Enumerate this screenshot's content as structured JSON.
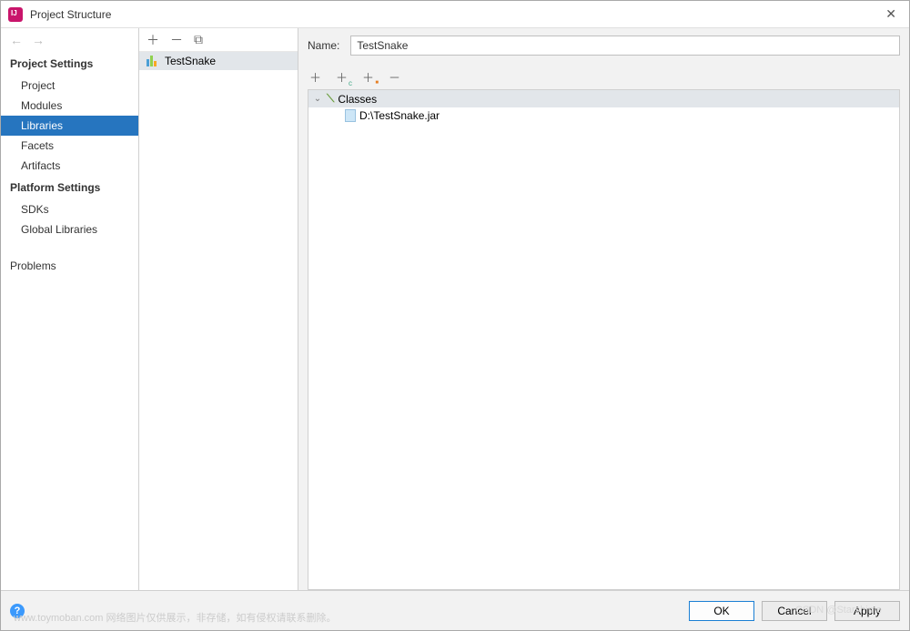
{
  "window": {
    "title": "Project Structure"
  },
  "sidebar": {
    "sections": [
      {
        "title": "Project Settings",
        "items": [
          "Project",
          "Modules",
          "Libraries",
          "Facets",
          "Artifacts"
        ],
        "selected": "Libraries"
      },
      {
        "title": "Platform Settings",
        "items": [
          "SDKs",
          "Global Libraries"
        ]
      }
    ],
    "extra": [
      "Problems"
    ]
  },
  "libraries": {
    "items": [
      {
        "name": "TestSnake"
      }
    ]
  },
  "detail": {
    "name_label": "Name:",
    "name_value": "TestSnake",
    "tree": {
      "group": "Classes",
      "files": [
        "D:\\TestSnake.jar"
      ]
    }
  },
  "buttons": {
    "ok": "OK",
    "cancel": "Cancel",
    "apply": "Apply"
  },
  "watermarks": {
    "left": "www.toymoban.com 网络图片仅供展示，非存储，如有侵权请联系删除。",
    "right": "CSDN @Starshime"
  }
}
